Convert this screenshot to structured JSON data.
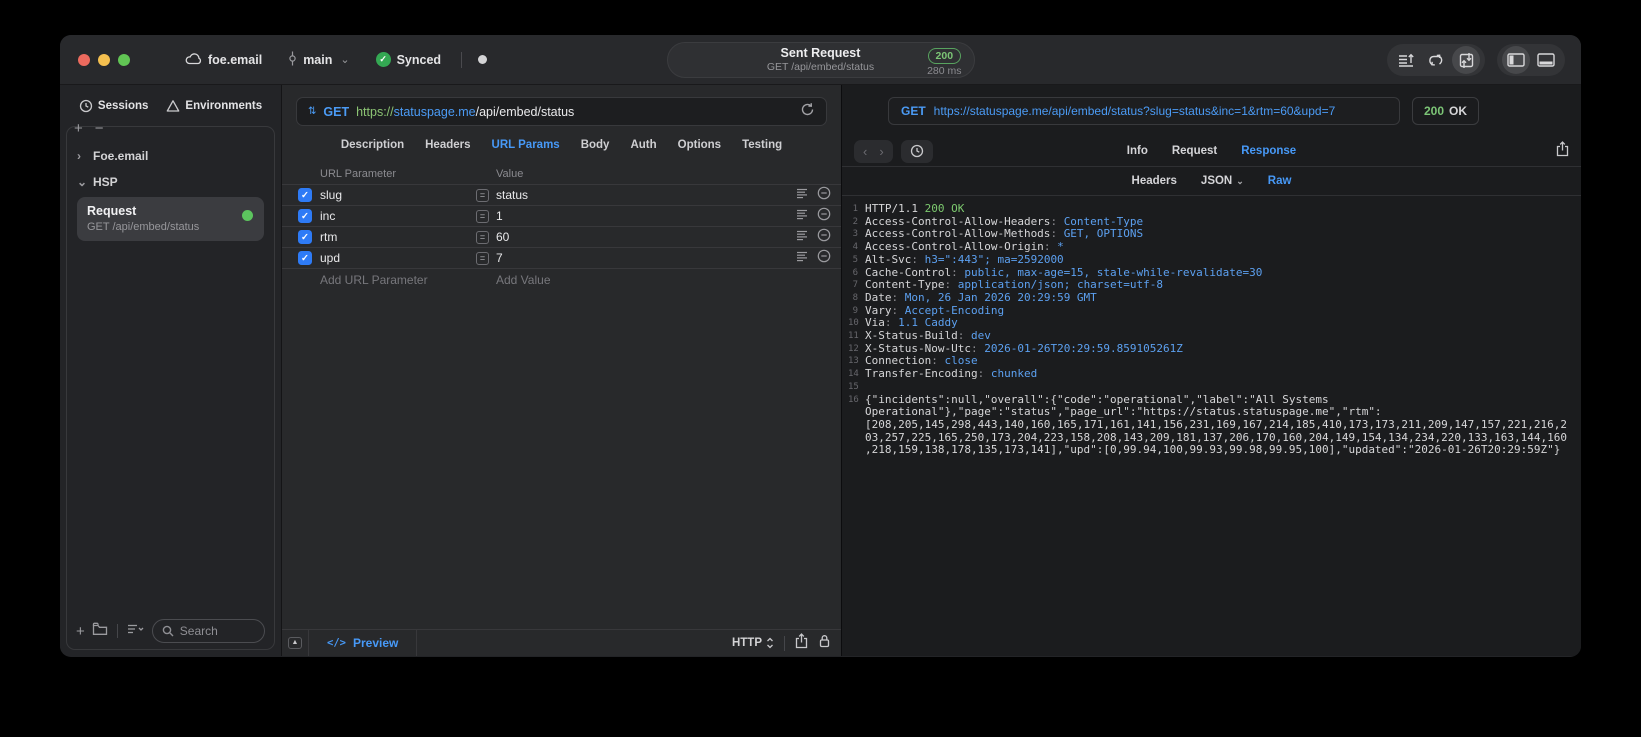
{
  "icons": {
    "check": "✓",
    "chevron_down": "⌄",
    "chevron_right": "›",
    "back": "‹",
    "forward": "›",
    "plus": "+",
    "minus": "−",
    "equals": "=",
    "method_stepper": "⇅",
    "collapse": "▲",
    "preview_code": "</>"
  },
  "titlebar": {
    "project": "foe.email",
    "branch": "main",
    "sync": "Synced",
    "request_title": "Sent Request",
    "request_subtitle": "GET /api/embed/status",
    "status_code": "200",
    "duration": "280 ms"
  },
  "sidebar": {
    "tabs": [
      {
        "label": "Sessions"
      },
      {
        "label": "Environments"
      }
    ],
    "groups": [
      {
        "label": "Foe.email"
      },
      {
        "label": "HSP"
      }
    ],
    "request": {
      "title": "Request",
      "subtitle": "GET /api/embed/status"
    },
    "search_placeholder": "Search"
  },
  "request_editor": {
    "method": "GET",
    "url": {
      "scheme": "https://",
      "host": "statuspage.me",
      "path": "/api/embed/status"
    },
    "tabs": [
      "Description",
      "Headers",
      "URL Params",
      "Body",
      "Auth",
      "Options",
      "Testing"
    ],
    "active_tab": "URL Params",
    "params": {
      "columns": {
        "name": "URL Parameter",
        "value": "Value"
      },
      "rows": [
        {
          "name": "slug",
          "value": "status"
        },
        {
          "name": "inc",
          "value": "1"
        },
        {
          "name": "rtm",
          "value": "60"
        },
        {
          "name": "upd",
          "value": "7"
        }
      ],
      "add_name": "Add URL Parameter",
      "add_value": "Add Value"
    },
    "footer": {
      "preview": "Preview",
      "protocol": "HTTP"
    }
  },
  "response": {
    "method": "GET",
    "url": "https://statuspage.me/api/embed/status?slug=status&inc=1&rtm=60&upd=7",
    "status_code": "200",
    "status_text": "OK",
    "tabs": [
      "Info",
      "Request",
      "Response"
    ],
    "active_tab": "Response",
    "subtabs": [
      "Headers",
      "JSON",
      "Raw"
    ],
    "active_subtab": "Raw",
    "code": {
      "separator": ": ",
      "status_line": {
        "ln": "1",
        "protocol": "HTTP/1.1 ",
        "status": "200 OK"
      },
      "headers": [
        {
          "ln": "2",
          "name": "Access-Control-Allow-Headers",
          "value": "Content-Type"
        },
        {
          "ln": "3",
          "name": "Access-Control-Allow-Methods",
          "value": "GET, OPTIONS"
        },
        {
          "ln": "4",
          "name": "Access-Control-Allow-Origin",
          "value": "*"
        },
        {
          "ln": "5",
          "name": "Alt-Svc",
          "value": "h3=\":443\"; ma=2592000"
        },
        {
          "ln": "6",
          "name": "Cache-Control",
          "value": "public, max-age=15, stale-while-revalidate=30"
        },
        {
          "ln": "7",
          "name": "Content-Type",
          "value": "application/json; charset=utf-8"
        },
        {
          "ln": "8",
          "name": "Date",
          "value": "Mon, 26 Jan 2026 20:29:59 GMT"
        },
        {
          "ln": "9",
          "name": "Vary",
          "value": "Accept-Encoding"
        },
        {
          "ln": "10",
          "name": "Via",
          "value": "1.1 Caddy"
        },
        {
          "ln": "11",
          "name": "X-Status-Build",
          "value": "dev"
        },
        {
          "ln": "12",
          "name": "X-Status-Now-Utc",
          "value": "2026-01-26T20:29:59.859105261Z"
        },
        {
          "ln": "13",
          "name": "Connection",
          "value": "close"
        },
        {
          "ln": "14",
          "name": "Transfer-Encoding",
          "value": "chunked"
        }
      ],
      "blank": {
        "ln": "15"
      },
      "body": {
        "ln": "16",
        "text": "{\"incidents\":null,\"overall\":{\"code\":\"operational\",\"label\":\"All Systems Operational\"},\"page\":\"status\",\"page_url\":\"https://status.statuspage.me\",\"rtm\":[208,205,145,298,443,140,160,165,171,161,141,156,231,169,167,214,185,410,173,173,211,209,147,157,221,216,203,257,225,165,250,173,204,223,158,208,143,209,181,137,206,170,160,204,149,154,134,234,220,133,163,144,160,218,159,138,178,135,173,141],\"upd\":[0,99.94,100,99.93,99.98,99.95,100],\"updated\":\"2026-01-26T20:29:59Z\"}"
      }
    }
  },
  "colors": {
    "accent_blue": "#4799f7",
    "value_blue": "#5ca0f0",
    "status_green": "#7cc576",
    "scheme_green": "#8cc474",
    "checkbox_blue": "#2e7bf6"
  }
}
